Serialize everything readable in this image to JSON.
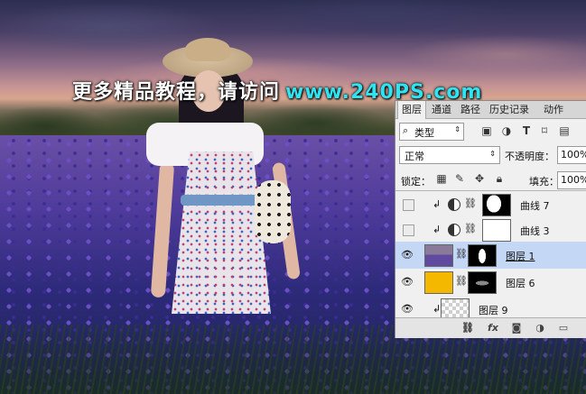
{
  "watermark": {
    "chinese": "更多精品教程，请访问",
    "url": "www.240PS.com"
  },
  "panel": {
    "tabs": [
      {
        "label": "图层",
        "active": true
      },
      {
        "label": "通道",
        "active": false
      },
      {
        "label": "路径",
        "active": false
      },
      {
        "label": "历史记录",
        "active": false
      },
      {
        "label": "动作",
        "active": false
      }
    ],
    "filter": {
      "kind_label": "类型",
      "icons": [
        "image-filter-icon",
        "adjustment-filter-icon",
        "type-filter-icon",
        "shape-filter-icon",
        "smart-object-filter-icon"
      ]
    },
    "blend_mode": "正常",
    "opacity_label": "不透明度：",
    "opacity_value": "100%",
    "lock_label": "锁定：",
    "fill_label": "填充：",
    "fill_value": "100%",
    "layers": [
      {
        "name": "曲线 7",
        "visible": false,
        "type": "adjustment",
        "clipped": true,
        "selected": false
      },
      {
        "name": "曲线 3",
        "visible": false,
        "type": "adjustment",
        "clipped": true,
        "selected": false
      },
      {
        "name": "图层 1",
        "visible": true,
        "type": "image",
        "clipped": false,
        "selected": true
      },
      {
        "name": "图层 6",
        "visible": true,
        "type": "solid",
        "clipped": false,
        "selected": false,
        "fill_color": "#f5b800"
      },
      {
        "name": "图层 9",
        "visible": true,
        "type": "image",
        "clipped": true,
        "selected": false
      }
    ],
    "footer_icons": [
      "link-layers-icon",
      "fx-icon",
      "add-mask-icon",
      "new-adjustment-icon",
      "new-group-icon"
    ],
    "colors": {
      "selected_row": "#c4d8f5",
      "panel_bg": "#f0f0f0",
      "watermark_url": "#2fe3f0"
    }
  }
}
